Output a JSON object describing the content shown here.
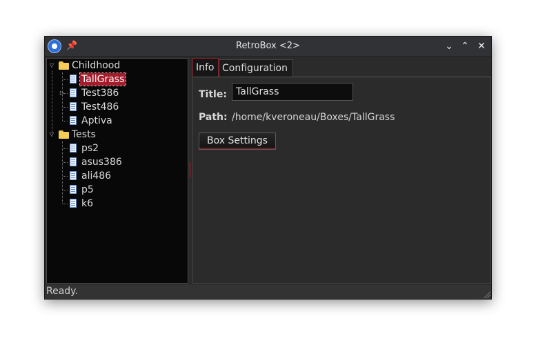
{
  "window": {
    "title": "RetroBox <2>",
    "pin_glyph": "📌",
    "minimize_glyph": "⌄",
    "maximize_glyph": "⌃",
    "close_glyph": "✕"
  },
  "tree": {
    "groups": [
      {
        "label": "Childhood",
        "icon": "folder-icon",
        "expanded": true,
        "items": [
          {
            "label": "TallGrass",
            "selected": true
          },
          {
            "label": "Test386",
            "has_children": true
          },
          {
            "label": "Test486"
          },
          {
            "label": "Aptiva"
          }
        ]
      },
      {
        "label": "Tests",
        "icon": "folder-icon",
        "expanded": true,
        "items": [
          {
            "label": "ps2"
          },
          {
            "label": "asus386"
          },
          {
            "label": "ali486"
          },
          {
            "label": "p5"
          },
          {
            "label": "k6"
          }
        ]
      }
    ]
  },
  "tabs": [
    {
      "label": "Info",
      "active": true
    },
    {
      "label": "Configuration",
      "active": false
    }
  ],
  "info": {
    "title_label": "Title:",
    "title_value": "TallGrass",
    "path_label": "Path:",
    "path_value": "/home/kveroneau/Boxes/TallGrass",
    "box_settings_label": "Box Settings"
  },
  "status": {
    "text": "Ready."
  },
  "colors": {
    "accent": "#a51d2d",
    "window_bg": "#2b2b2b",
    "tree_bg": "#080808"
  }
}
